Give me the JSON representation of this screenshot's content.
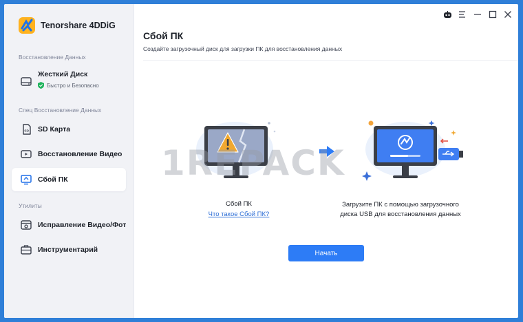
{
  "app": {
    "name": "Tenorshare 4DDiG"
  },
  "sidebar": {
    "sections": [
      {
        "title": "Восстановление Данных"
      },
      {
        "title": "Спец Восстановление Данных"
      },
      {
        "title": "Утилиты"
      }
    ],
    "disk": {
      "label": "Жесткий Диск",
      "sublabel": "Быстро и Безопасно"
    },
    "items": [
      {
        "label": "SD Карта",
        "icon": "sd-card-icon"
      },
      {
        "label": "Восстановление Видео",
        "icon": "video-icon"
      },
      {
        "label": "Сбой ПК",
        "icon": "pc-crash-icon",
        "active": true
      },
      {
        "label": "Исправление Видео/Фот",
        "icon": "repair-icon"
      },
      {
        "label": "Инструментарий",
        "icon": "toolbox-icon"
      }
    ]
  },
  "main": {
    "title": "Сбой ПК",
    "subtitle": "Создайте загрузочный диск для загрузки ПК для восстановления данных",
    "step1": {
      "caption": "Сбой ПК",
      "link": "Что такое Сбой ПК?"
    },
    "step2": {
      "caption": "Загрузите ПК с помощью загрузочного диска USB для восстановления данных"
    },
    "start_button": "Начать"
  },
  "watermark": "1REPACK",
  "colors": {
    "accent": "#2d7cf6",
    "warning": "#f0a830",
    "sidebar_bg": "#f1f2f6",
    "desktop": "#2f7fd8"
  }
}
